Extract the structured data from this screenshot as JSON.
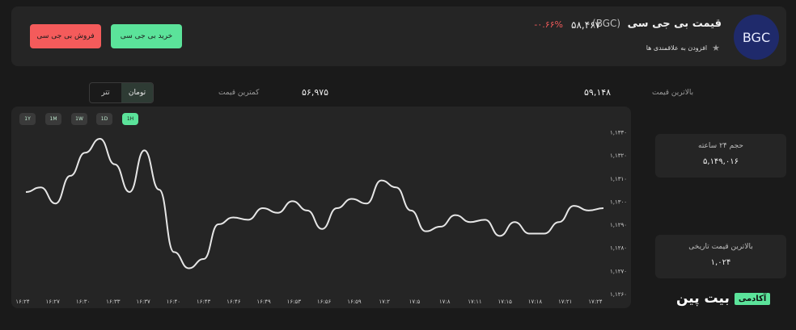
{
  "coin": {
    "logo_text": "BGC",
    "name": "قیمت بی جی سی",
    "symbol": "(BGC)",
    "price": "۵۸,۴۶۷",
    "change": "-۰.۶۶%",
    "favorite_label": "افزودن به علاقمندی ها"
  },
  "actions": {
    "buy_label": "خرید بی جی سی",
    "sell_label": "فروش بی جی سی"
  },
  "stats": {
    "high_label": "بالاترین قیمت",
    "high_value": "۵۹,۱۴۸",
    "low_label": "کمترین قیمت",
    "low_value": "۵۶,۹۷۵"
  },
  "currency": {
    "options": [
      "تومان",
      "تتر"
    ],
    "selected": "تومان"
  },
  "ranges": {
    "options": [
      "1H",
      "1D",
      "1W",
      "1M",
      "1Y"
    ],
    "selected": "1H"
  },
  "side": {
    "volume_label": "حجم ۲۴ ساعته",
    "volume_value": "۵,۱۴۹,۰۱۶",
    "ath_label": "بالاترین قیمت تاریخی",
    "ath_value": "۱,۰۲۴"
  },
  "brand": {
    "name": "بیت پین",
    "tag": "آکادمی"
  },
  "colors": {
    "accent": "#5be39a",
    "negative": "#ef5a5a",
    "line": "#e6e6e6"
  },
  "chart_data": {
    "type": "line",
    "x_labels": [
      "۱۶:۲۴",
      "۱۶:۲۷",
      "۱۶:۳۰",
      "۱۶:۳۳",
      "۱۶:۳۷",
      "۱۶:۴۰",
      "۱۶:۴۳",
      "۱۶:۴۶",
      "۱۶:۴۹",
      "۱۶:۵۳",
      "۱۶:۵۶",
      "۱۶:۵۹",
      "۱۷:۲",
      "۱۷:۵",
      "۱۷:۸",
      "۱۷:۱۱",
      "۱۷:۱۵",
      "۱۷:۱۸",
      "۱۷:۲۱",
      "۱۷:۲۴"
    ],
    "y_ticks": [
      "۱,۱۳۳۰",
      "۱,۱۳۲۰",
      "۱,۱۳۱۰",
      "۱,۱۳۰۰",
      "۱,۱۲۹۰",
      "۱,۱۲۸۰",
      "۱,۱۲۷۰",
      "۱,۱۲۶۰"
    ],
    "y_tick_values": [
      11330,
      11320,
      11310,
      11300,
      11290,
      11280,
      11270,
      11260
    ],
    "ylim": [
      11260,
      11334
    ],
    "y": [
      11304,
      11306,
      11299,
      11311,
      11321,
      11327,
      11316,
      11304,
      11322,
      11305,
      11278,
      11271,
      11275,
      11290,
      11293,
      11292,
      11297,
      11295,
      11300,
      11296,
      11288,
      11297,
      11301,
      11299,
      11309,
      11306,
      11296,
      11287,
      11289,
      11294,
      11291,
      11292,
      11285,
      11291,
      11286,
      11286,
      11291,
      11298,
      11296,
      11297
    ]
  }
}
